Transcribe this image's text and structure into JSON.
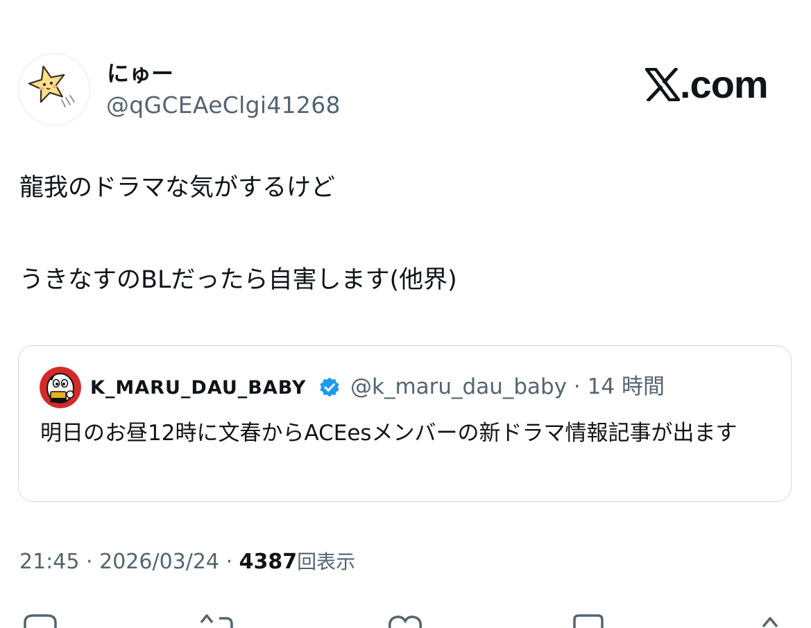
{
  "tweet": {
    "author": {
      "display_name": "にゅー",
      "handle": "@qGCEAeClgi41268",
      "avatar_icon": "star-avatar-icon"
    },
    "brand": {
      "text": ".com",
      "logo_icon": "x-logo-icon"
    },
    "text_lines": [
      "龍我のドラマな気がするけど",
      "うきなすのBLだったら自害します(他界)"
    ],
    "quote": {
      "display_name": "K_MARU_DAU_BABY",
      "verified": true,
      "handle": "@k_maru_dau_baby",
      "separator": "·",
      "time_ago": "14 時間",
      "text": "明日のお昼12時に文春からACEesメンバーの新ドラマ情報記事が出ます"
    },
    "meta": {
      "time": "21:45",
      "date": "2026/03/24",
      "separator": "·",
      "views_count": "4387",
      "views_label": "回表示"
    }
  },
  "colors": {
    "text_primary": "#0f1419",
    "text_secondary": "#536471",
    "border": "#cfd9de",
    "verified": "#1d9bf0"
  }
}
